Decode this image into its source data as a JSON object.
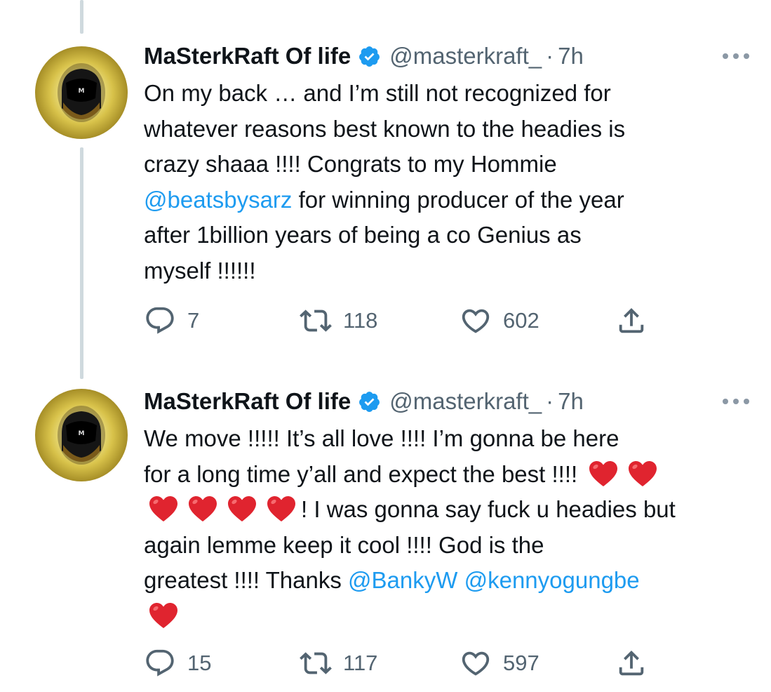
{
  "tweets": [
    {
      "author_name": "MaSterkRaft Of life",
      "handle": "@masterkraft_",
      "separator": "·",
      "time": "7h",
      "text_lines": [
        [
          {
            "t": "On my back … and I’m still not recognized for"
          }
        ],
        [
          {
            "t": "whatever reasons best known to the headies is"
          }
        ],
        [
          {
            "t": "crazy shaaa !!!! Congrats to my Hommie"
          }
        ],
        [
          {
            "t": "@beatsbysarz",
            "mention": true
          },
          {
            "t": " for winning producer of the year"
          }
        ],
        [
          {
            "t": "after 1billion years of being a co Genius as"
          }
        ],
        [
          {
            "t": "myself !!!!!!"
          }
        ]
      ],
      "replies": "7",
      "retweets": "118",
      "likes": "602"
    },
    {
      "author_name": "MaSterkRaft Of life",
      "handle": "@masterkraft_",
      "separator": "·",
      "time": "7h",
      "text_lines": [
        [
          {
            "t": "We move !!!!! It’s all love !!!! I’m gonna be here"
          }
        ],
        [
          {
            "t": "for a long time y’all and expect the best !!!! "
          },
          {
            "emoji": "red-heart"
          },
          {
            "emoji": "red-heart"
          }
        ],
        [
          {
            "emoji": "red-heart"
          },
          {
            "emoji": "red-heart"
          },
          {
            "emoji": "red-heart"
          },
          {
            "emoji": "red-heart"
          },
          {
            "t": "! I was gonna say fuck u headies but"
          }
        ],
        [
          {
            "t": "again lemme keep it cool !!!! God is the"
          }
        ],
        [
          {
            "t": "greatest !!!! Thanks "
          },
          {
            "t": "@BankyW",
            "mention": true
          },
          {
            "t": " "
          },
          {
            "t": "@kennyogungbe",
            "mention": true
          }
        ],
        [
          {
            "emoji": "red-heart"
          }
        ]
      ],
      "replies": "15",
      "retweets": "117",
      "likes": "597"
    }
  ],
  "colors": {
    "text": "#0f1419",
    "secondary": "#536471",
    "mention": "#1d9bf0",
    "verified": "#1d9bf0",
    "thread_line": "#cfd9de",
    "heart_emoji": "#e0242f"
  },
  "icons": {
    "verified": "verified-badge-icon",
    "more": "more-horizontal-icon",
    "reply": "reply-icon",
    "retweet": "retweet-icon",
    "like": "heart-outline-icon",
    "share": "share-icon",
    "emoji": "red-heart-emoji"
  }
}
